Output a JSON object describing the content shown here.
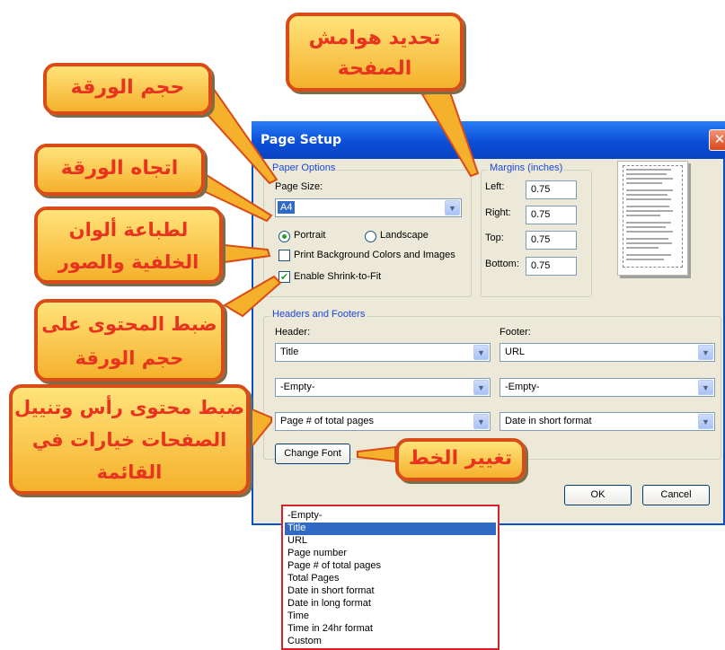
{
  "dialog": {
    "title": "Page Setup",
    "close_glyph": "✕",
    "paper_options": {
      "legend": "Paper Options",
      "page_size_label": "Page Size:",
      "page_size_value": "A4",
      "portrait_label": "Portrait",
      "landscape_label": "Landscape",
      "orientation_selected": "Portrait",
      "print_background_label": "Print Background Colors and Images",
      "print_background_checked": false,
      "shrink_label": "Enable Shrink-to-Fit",
      "shrink_checked": true
    },
    "margins": {
      "legend": "Margins (inches)",
      "left_label": "Left:",
      "left_value": "0.75",
      "right_label": "Right:",
      "right_value": "0.75",
      "top_label": "Top:",
      "top_value": "0.75",
      "bottom_label": "Bottom:",
      "bottom_value": "0.75"
    },
    "headers_footers": {
      "legend": "Headers and Footers",
      "header_label": "Header:",
      "footer_label": "Footer:",
      "header_values": [
        "Title",
        "-Empty-",
        "Page # of total pages"
      ],
      "footer_values": [
        "URL",
        "-Empty-",
        "Date in short format"
      ]
    },
    "buttons": {
      "change_font": "Change Font",
      "ok": "OK",
      "cancel": "Cancel"
    }
  },
  "dropdown_options": [
    "-Empty-",
    "Title",
    "URL",
    "Page number",
    "Page # of total pages",
    "Total Pages",
    "Date in short format",
    "Date in long format",
    "Time",
    "Time in 24hr format",
    "Custom"
  ],
  "dropdown_highlighted": "Title",
  "callouts": {
    "margins": "تحديد هوامش الصفحة",
    "paper_size": "حجم الورقة",
    "orientation": "اتجاه الورقة",
    "print_colors": "لطباعة ألوان الخلفية والصور",
    "shrink": "ضبط المحتوى على حجم الورقة",
    "header_footer": "ضبط محتوى رأس وتنييل الصفحات خيارات في القائمة",
    "font": "تغيير الخط"
  },
  "colors": {
    "callout_fill": "#f5b12c",
    "callout_border": "#d94b17",
    "callout_text": "#e8341f",
    "titlebar": "#0b4fd8",
    "dropdown_border": "#d6232a",
    "highlight": "#316ac5"
  }
}
